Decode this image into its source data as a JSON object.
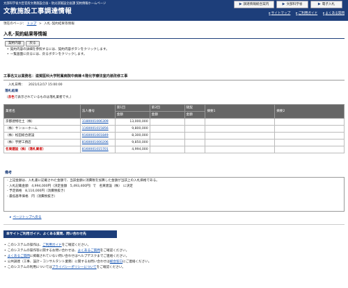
{
  "header": {
    "subtitle": "文部科学省大臣官房文教施設企画・防災部施設企画課 契約情報ホームページ",
    "title": "文教施設工事調達情報",
    "buttons": {
      "procurement_label": "調達情報総合案内",
      "mext_label": "文部科学省",
      "ebid_label": "電子入札"
    },
    "links": {
      "sitemap": "サイトマップ",
      "guide": "ご利用ガイド",
      "faq": "よくある質問"
    }
  },
  "breadcrumb": {
    "prefix": "現在のページ：",
    "top": "トップ",
    "current": "入札･契約結果等情報"
  },
  "page_title": "入札･契約結果等情報",
  "actions": {
    "contract_label": "契約内容",
    "back_label": "戻る"
  },
  "notes": [
    "契約内容の詳細を参照するには、契約内容ボタンをクリックします。",
    "一覧画面に戻るには、戻るボタンをクリックします。"
  ],
  "project": {
    "label": "工事名又は業務名：滋賀医科大学附属病院中病棟４階化学療法室内装改修工事",
    "date_label": "入札日時：",
    "date_value": "2021/12/17 15:00:00"
  },
  "results": {
    "section_label": "落札結果",
    "note_prefix": "（",
    "note_red": "赤色",
    "note_suffix": "で表示されているものは落札業者です。）",
    "headers": {
      "company": "業者名",
      "corp_no": "法人番号",
      "round1": "第1回",
      "round2": "第2回",
      "free_contract": "随契",
      "remark1": "摘要1",
      "remark2": "摘要2",
      "amount": "金額"
    },
    "rows": [
      {
        "company": "京都建物社土（株）",
        "corp_no": "3180001006309",
        "amount": "13,000,000"
      },
      {
        "company": "（株）サンユーホーム",
        "corp_no": "1160001015856",
        "amount": "9,800,000"
      },
      {
        "company": "（株）松田総合建設",
        "corp_no": "9160001001849",
        "amount": "8,300,000"
      },
      {
        "company": "（株）宇野工務店",
        "corp_no": "8160001000206",
        "amount": "9,850,000"
      },
      {
        "company": "名東建設（株）（落札業者）",
        "corp_no": "8160001015701",
        "amount": "4,994,000"
      }
    ]
  },
  "remarks": {
    "label": "備考",
    "lines": [
      "- 上記金額は、入札書に記載された金額で、当該金額に消費税を加算した金額が当該上の入札価格である。",
      "- 入札記載金額　4,994,000円（決定金額　5,493,400円）で　名東建設（株）　に決定",
      "- 予定価格　8,110,000円（消費税抜き）",
      "- 最低基準価格　円（消費税抜き）"
    ]
  },
  "pagetop": "ページトップへ戻る",
  "guide": {
    "title": "本サイトご利用ガイド、よくある質問、問い合わせ先",
    "items": [
      {
        "pre": "このシステムの操作は、",
        "link": "ご利用ガイド",
        "post": "をご確認ください。"
      },
      {
        "pre": "このシステムの操作等に関するお問い合わせは、",
        "link": "よくあるご質問",
        "post": "をご確認ください。"
      },
      {
        "pre": "",
        "link": "よくあるご質問",
        "post": "に掲載されていない問い合わせはヘルプデスクまでご連絡ください。"
      },
      {
        "pre": "公共調達（工事、設計・コンサルタント業務）に関するお問い合わせは",
        "link": "総合窓口",
        "post": "にご連絡ください。"
      },
      {
        "pre": "このシステムの利用については",
        "link": "プライバシーポリシーについて",
        "post": "をご確認ください。"
      }
    ]
  },
  "colors": {
    "header_bg": "#1d3e7a",
    "table_header_bg": "#666666",
    "winner_text": "#cc0000",
    "link": "#0044aa"
  }
}
